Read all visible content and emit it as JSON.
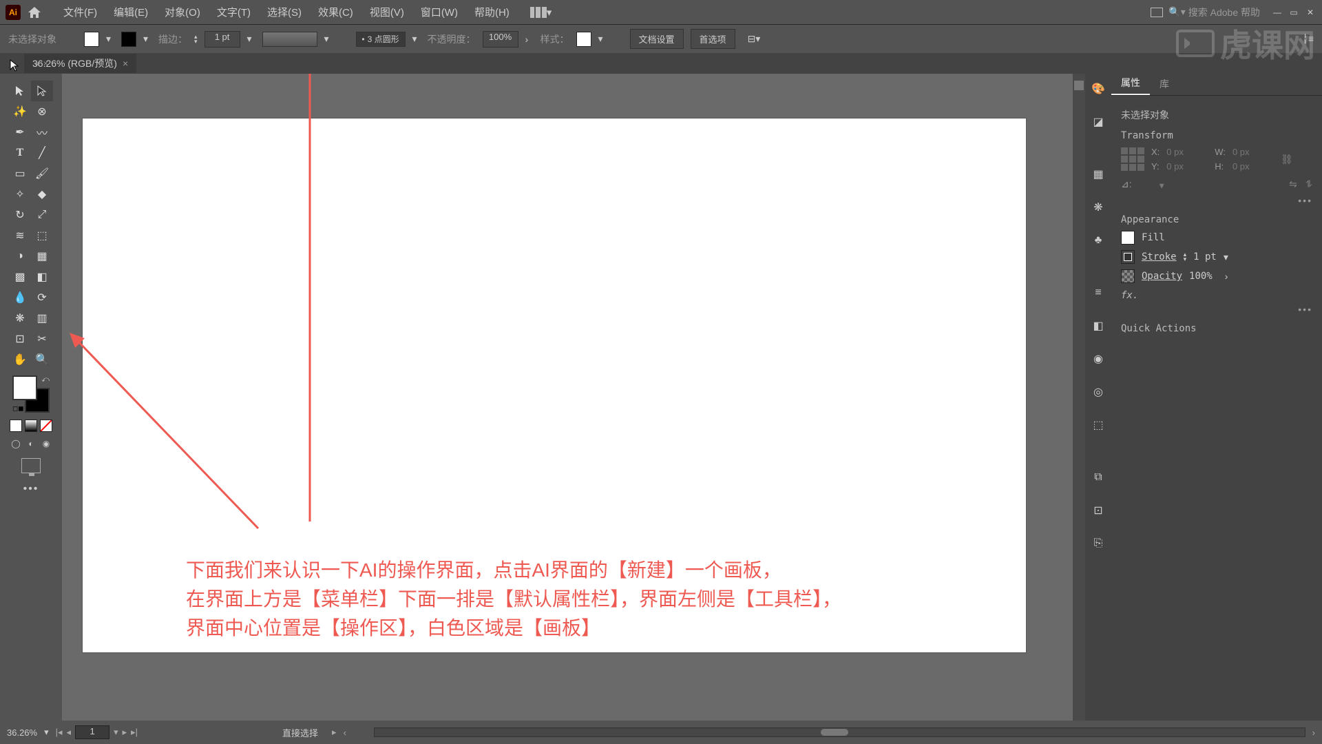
{
  "menubar": {
    "items": [
      "文件(F)",
      "编辑(E)",
      "对象(O)",
      "文字(T)",
      "选择(S)",
      "效果(C)",
      "视图(V)",
      "窗口(W)",
      "帮助(H)"
    ],
    "search_placeholder": "搜索 Adobe 帮助"
  },
  "controlbar": {
    "no_selection": "未选择对象",
    "stroke_label": "描边：",
    "stroke_width": "1 pt",
    "dash_label": "3 点圆形",
    "opacity_label": "不透明度：",
    "opacity_value": "100%",
    "style_label": "样式：",
    "doc_setup": "文档设置",
    "prefs": "首选项"
  },
  "doc_tab": {
    "title": "36.26% (RGB/预览)"
  },
  "properties": {
    "tabs": [
      "属性",
      "库"
    ],
    "no_selection": "未选择对象",
    "transform_title": "Transform",
    "tx": {
      "x_label": "X:",
      "x": "0 px",
      "y_label": "Y:",
      "y": "0 px",
      "w_label": "W:",
      "w": "0 px",
      "h_label": "H:",
      "h": "0 px",
      "angle_label": "⊿:"
    },
    "appearance_title": "Appearance",
    "fill_label": "Fill",
    "stroke_label": "Stroke",
    "stroke_val": "1 pt",
    "opacity_label": "Opacity",
    "opacity_val": "100%",
    "fx_label": "fx.",
    "quick_actions": "Quick Actions"
  },
  "status": {
    "zoom": "36.26%",
    "artboard": "1",
    "tool": "直接选择"
  },
  "annotation": {
    "line1": "下面我们来认识一下AI的操作界面，点击AI界面的【新建】一个画板，",
    "line2": "在界面上方是【菜单栏】下面一排是【默认属性栏】，界面左侧是【工具栏】，",
    "line3": "界面中心位置是【操作区】，白色区域是【画板】"
  },
  "watermark": "虎课网"
}
